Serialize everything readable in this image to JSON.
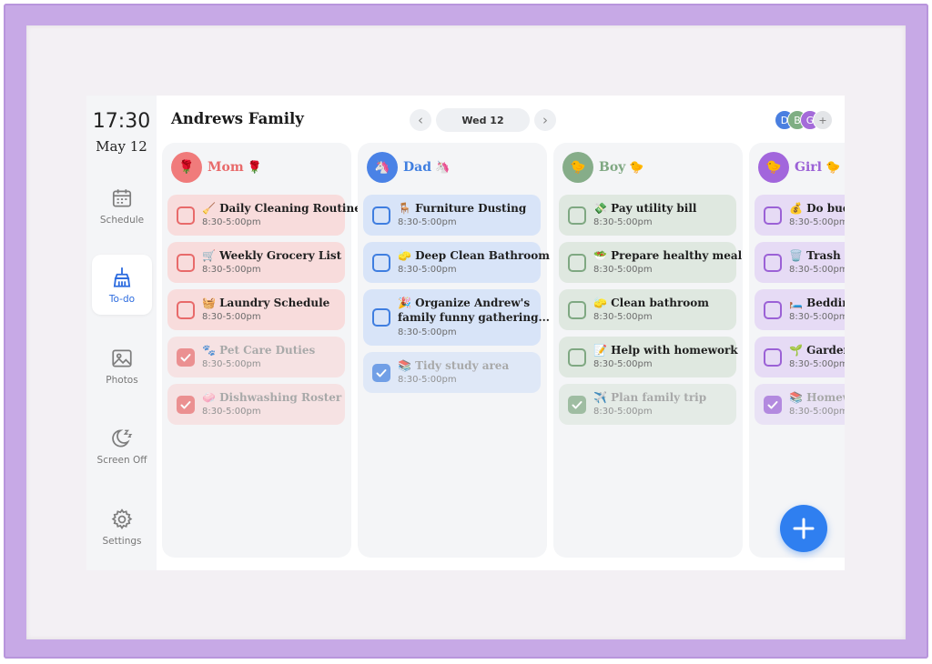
{
  "sidebar": {
    "clock": "17:30",
    "date": "May 12",
    "items": [
      {
        "label": "Schedule",
        "icon": "calendar-icon"
      },
      {
        "label": "To-do",
        "icon": "broom-icon",
        "active": true
      },
      {
        "label": "Photos",
        "icon": "image-icon"
      },
      {
        "label": "Screen Off",
        "icon": "moon-icon"
      },
      {
        "label": "Settings",
        "icon": "gear-icon"
      }
    ]
  },
  "header": {
    "title": "Andrews Family",
    "date_label": "Wed 12",
    "prev_icon": "chevron-left-icon",
    "next_icon": "chevron-right-icon",
    "avatars": [
      "D",
      "B",
      "G",
      "+"
    ]
  },
  "colors": {
    "accent": "#2f7ff0",
    "mom": "#e86a6a",
    "dad": "#3f7ee0",
    "boy": "#7fa882",
    "girl": "#9b61d6"
  },
  "columns": [
    {
      "name": "Mom",
      "emoji": "🌹",
      "avatar": "🌹",
      "tasks": [
        {
          "title": "🧹 Daily Cleaning Routine",
          "time": "8:30-5:00pm",
          "done": false
        },
        {
          "title": "🛒 Weekly Grocery List",
          "time": "8:30-5:00pm",
          "done": false
        },
        {
          "title": "🧺 Laundry Schedule",
          "time": "8:30-5:00pm",
          "done": false
        },
        {
          "title": "🐾 Pet Care Duties",
          "time": "8:30-5:00pm",
          "done": true
        },
        {
          "title": "🧼 Dishwashing Roster",
          "time": "8:30-5:00pm",
          "done": true
        }
      ]
    },
    {
      "name": "Dad",
      "emoji": "🦄",
      "avatar": "🦄",
      "tasks": [
        {
          "title": "🪑 Furniture Dusting",
          "time": "8:30-5:00pm",
          "done": false
        },
        {
          "title": "🧽 Deep Clean Bathroom",
          "time": "8:30-5:00pm",
          "done": false
        },
        {
          "title": "🎉 Organize Andrew's",
          "title2": "family funny gathering...",
          "time": "8:30-5:00pm",
          "done": false
        },
        {
          "title": "📚 Tidy study area",
          "time": "8:30-5:00pm",
          "done": true
        }
      ]
    },
    {
      "name": "Boy",
      "emoji": "🐤",
      "avatar": "🐤",
      "tasks": [
        {
          "title": "💸 Pay utility bill",
          "time": "8:30-5:00pm",
          "done": false
        },
        {
          "title": "🥗 Prepare healthy meal",
          "time": "8:30-5:00pm",
          "done": false
        },
        {
          "title": "🧽 Clean bathroom",
          "time": "8:30-5:00pm",
          "done": false
        },
        {
          "title": "📝 Help with homework",
          "time": "8:30-5:00pm",
          "done": false
        },
        {
          "title": "✈️ Plan family trip",
          "time": "8:30-5:00pm",
          "done": true
        }
      ]
    },
    {
      "name": "Girl",
      "emoji": "🐤",
      "avatar": "🐤",
      "tasks": [
        {
          "title": "💰 Do budg",
          "time": "8:30-5:00pm",
          "done": false
        },
        {
          "title": "🗑️ Trash &",
          "time": "8:30-5:00pm",
          "done": false
        },
        {
          "title": "🛏️ Bedding",
          "time": "8:30-5:00pm",
          "done": false
        },
        {
          "title": "🌱 Garden",
          "time": "8:30-5:00pm",
          "done": false
        },
        {
          "title": "📚 Homew",
          "time": "8:30-5:00pm",
          "done": true
        }
      ]
    }
  ],
  "fab_icon": "plus-icon"
}
